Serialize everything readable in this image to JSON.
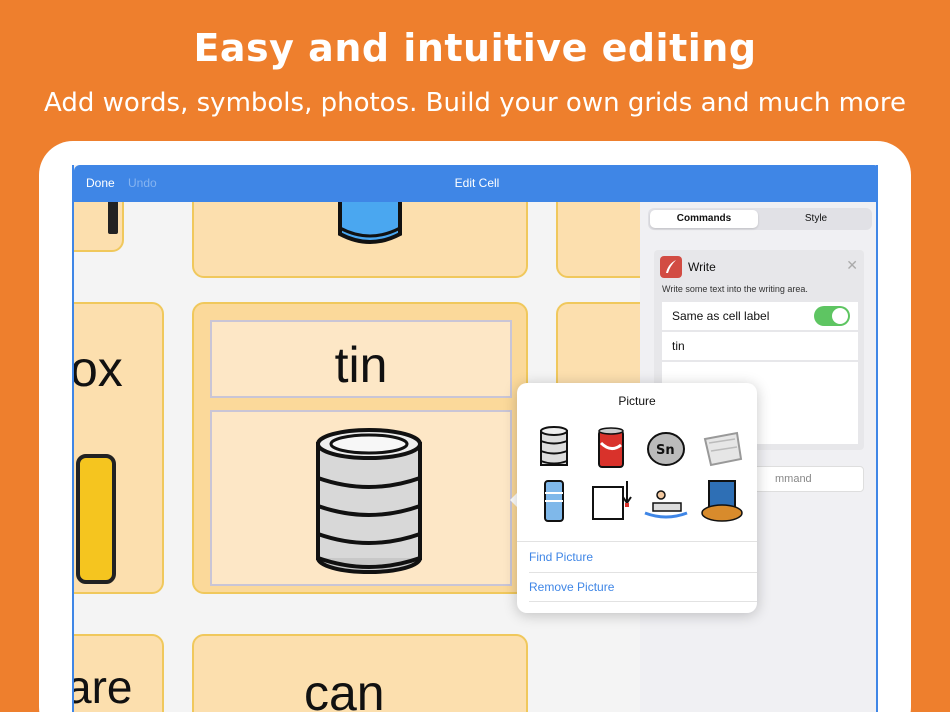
{
  "hero": {
    "title": "Easy and intuitive editing",
    "subtitle": "Add words, symbols, photos. Build your own grids and much more"
  },
  "navbar": {
    "done_label": "Done",
    "undo_label": "Undo",
    "title": "Edit Cell"
  },
  "grid": {
    "cells": {
      "box_partial": "ox",
      "share_partial": "are",
      "can": "can"
    },
    "selected_cell": {
      "label": "tin",
      "picture": "tin-can-symbol"
    }
  },
  "side_panel": {
    "tabs": [
      {
        "label": "Commands",
        "active": true
      },
      {
        "label": "Style",
        "active": false
      }
    ],
    "command": {
      "title": "Write",
      "description": "Write some text into the writing area.",
      "same_as_label": "Same as cell label",
      "same_as_label_on": true,
      "text_value": "tin"
    },
    "add_command_placeholder": "mmand"
  },
  "popover": {
    "title": "Picture",
    "thumbnails": [
      "tin-can",
      "soda-can",
      "tin-element-coin",
      "foil-wrap",
      "aerosol-can",
      "square-arrow",
      "person-boat",
      "beans-can"
    ],
    "find_label": "Find Picture",
    "remove_label": "Remove Picture"
  },
  "colors": {
    "background": "#ee7f2d",
    "accent": "#3f86e6",
    "cell_fill": "#fcdfae",
    "cell_border": "#f0c85c",
    "toggle_on": "#5ec562"
  }
}
